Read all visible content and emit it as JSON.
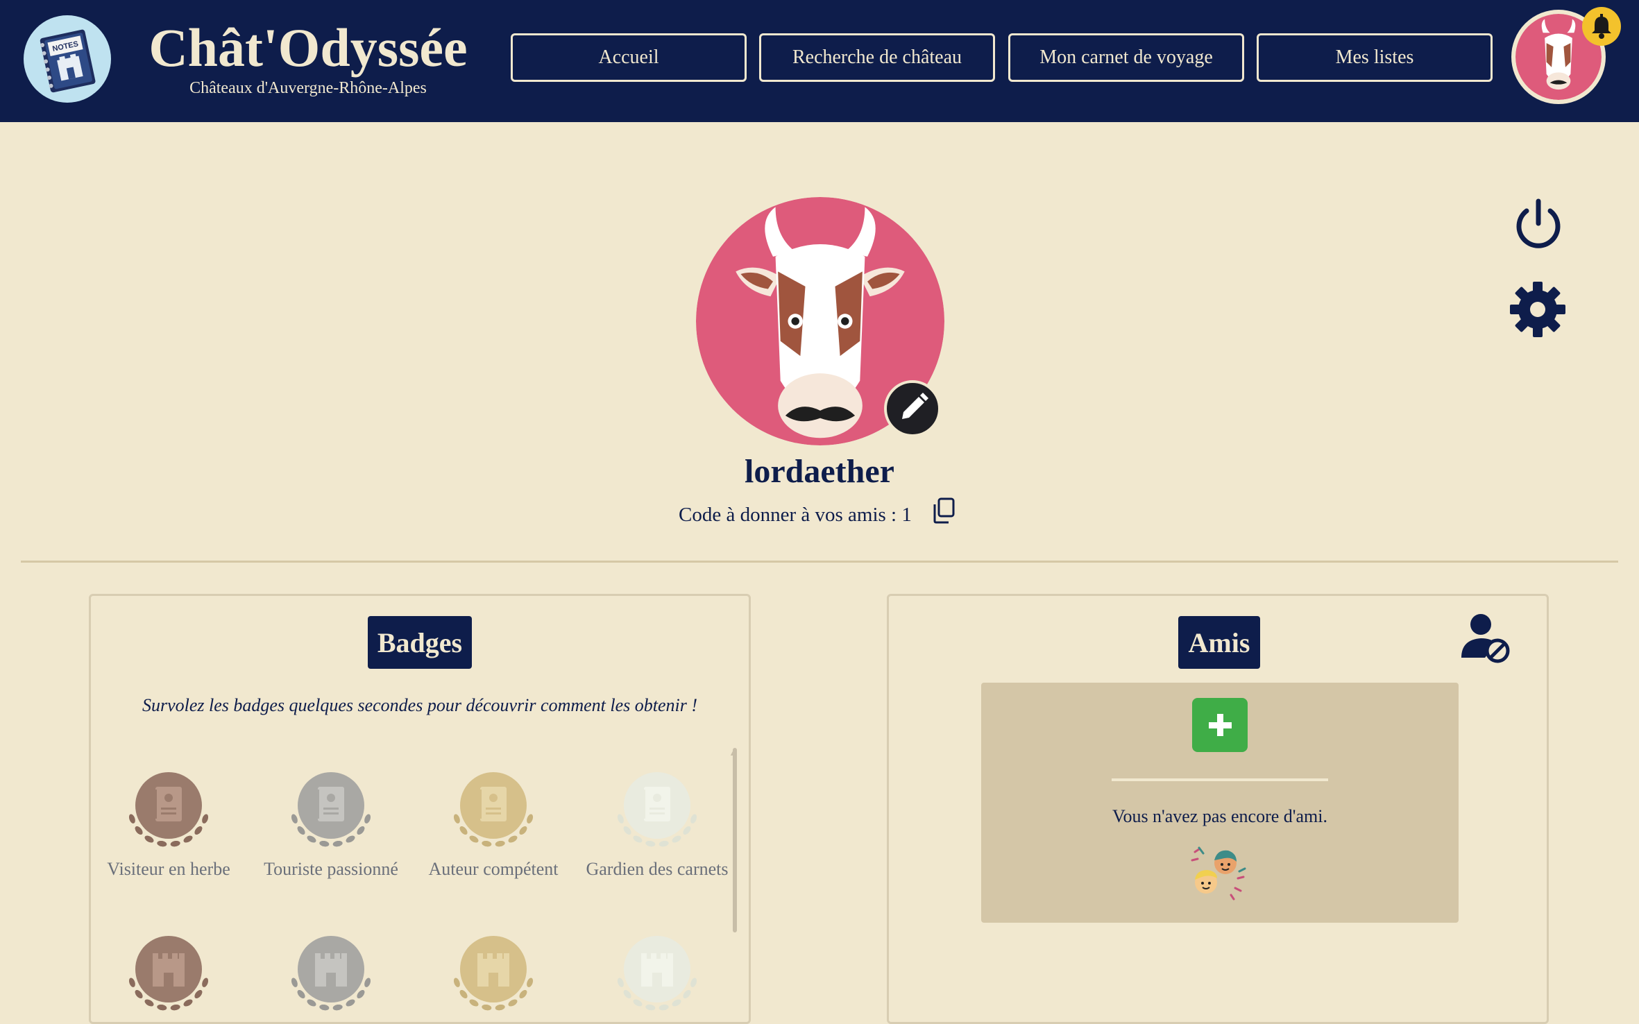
{
  "header": {
    "title": "Chât'Odyssée",
    "subtitle": "Châteaux d'Auvergne-Rhône-Alpes",
    "nav": [
      {
        "label": "Accueil"
      },
      {
        "label": "Recherche de château"
      },
      {
        "label": "Mon carnet de voyage"
      },
      {
        "label": "Mes listes"
      }
    ],
    "logo_text": "NOTES"
  },
  "profile": {
    "username": "lordaether",
    "friend_code_label": "Code à donner à vos amis : 1"
  },
  "badges": {
    "title": "Badges",
    "hint": "Survolez les badges quelques secondes pour découvrir comment les obtenir !",
    "items": [
      {
        "label": "Visiteur en herbe",
        "tier": "bronze",
        "icon": "notebook-icon"
      },
      {
        "label": "Touriste passionné",
        "tier": "silver",
        "icon": "notebook-icon"
      },
      {
        "label": "Auteur compétent",
        "tier": "gold",
        "icon": "notebook-icon"
      },
      {
        "label": "Gardien des carnets",
        "tier": "platinum",
        "icon": "notebook-icon"
      },
      {
        "label": "",
        "tier": "bronze",
        "icon": "castle-icon"
      },
      {
        "label": "",
        "tier": "silver",
        "icon": "castle-icon"
      },
      {
        "label": "",
        "tier": "gold",
        "icon": "castle-icon"
      },
      {
        "label": "",
        "tier": "platinum",
        "icon": "castle-icon"
      }
    ]
  },
  "friends": {
    "title": "Amis",
    "empty_message": "Vous n'avez pas encore d'ami."
  },
  "colors": {
    "navy": "#0e1d4b",
    "cream": "#f1e8cf",
    "avatar_pink": "#de5b7b",
    "add_green": "#3fad47",
    "bell_yellow": "#f3c22c"
  }
}
